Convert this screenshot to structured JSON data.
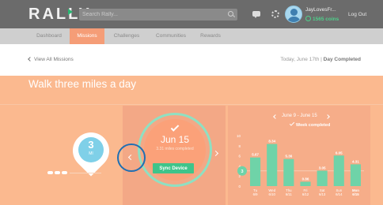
{
  "app": {
    "logo": "RALLY"
  },
  "search": {
    "placeholder": "Search Rally..."
  },
  "user": {
    "name": "JayLovesFr...",
    "coins": "1565 coins",
    "logout": "Log Out"
  },
  "nav": {
    "items": [
      {
        "label": "Dashboard",
        "active": false
      },
      {
        "label": "Missions",
        "active": true
      },
      {
        "label": "Challenges",
        "active": false
      },
      {
        "label": "Communities",
        "active": false
      },
      {
        "label": "Rewards",
        "active": false
      }
    ]
  },
  "subheader": {
    "back": "View All Missions",
    "date_prefix": "Today, June 17th |",
    "day_status": "Day Completed"
  },
  "mission": {
    "title": "Walk three miles a day",
    "goal_value": "3",
    "goal_unit": "MI"
  },
  "day": {
    "date": "Jun 15",
    "progress": "3.31 miles completed",
    "sync_label": "Sync Device"
  },
  "week": {
    "range": "June 9 - June 15",
    "status": "Week completed"
  },
  "colors": {
    "hero_bg": "#fbb98f",
    "accent_orange": "#f59d77",
    "bar_green": "#6fd3a8",
    "button_green": "#3fc48a",
    "focus_ring_blue": "#1f6fb3"
  },
  "chart_data": {
    "type": "bar",
    "categories": [
      "Tu 6/9",
      "Wed 6/10",
      "Thu 6/11",
      "Fri 6/12",
      "Sat 6/13",
      "Sun 6/14",
      "Mon 6/15"
    ],
    "values": [
      5.67,
      8.34,
      5.36,
      0.86,
      3.05,
      6.05,
      4.31
    ],
    "value_labels": [
      "5.67",
      "8.34",
      "5.36",
      "0.86",
      "3.05",
      "6.05",
      "4.31"
    ],
    "goal_line": 3,
    "yticks": [
      0,
      2,
      4,
      6,
      8,
      10
    ],
    "ylim": [
      0,
      10
    ],
    "highlight_index": 6,
    "title": "",
    "xlabel": "",
    "ylabel": ""
  }
}
